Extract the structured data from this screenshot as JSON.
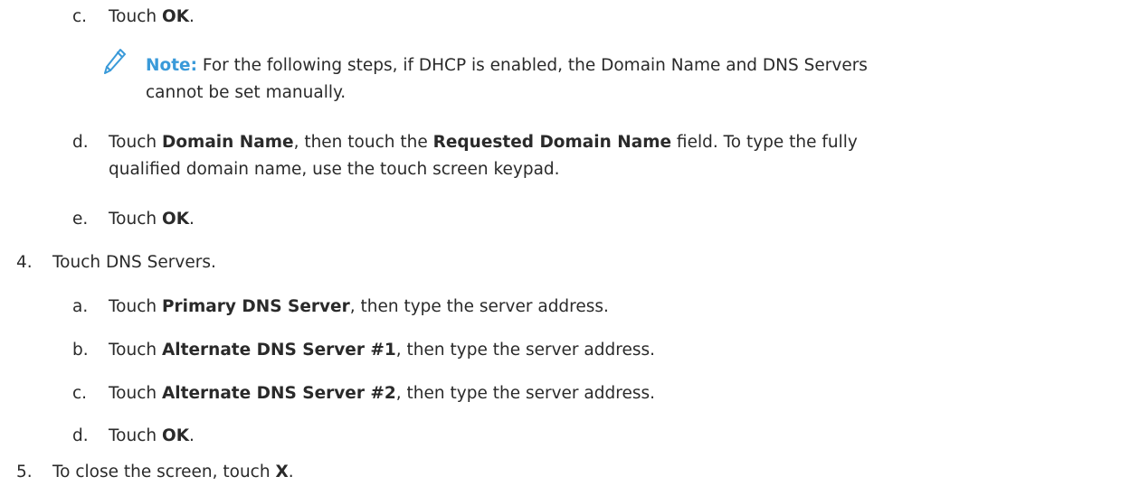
{
  "steps": [
    {
      "marker": "c.",
      "parts": [
        {
          "t": "Touch "
        },
        {
          "t": "OK",
          "b": true
        },
        {
          "t": "."
        }
      ]
    },
    {
      "marker": "d.",
      "parts": [
        {
          "t": "Touch "
        },
        {
          "t": "Domain Name",
          "b": true
        },
        {
          "t": ", then touch the "
        },
        {
          "t": "Requested Domain Name",
          "b": true
        },
        {
          "t": " field. To type the fully"
        }
      ],
      "continuation": "qualified domain name, use the touch screen keypad."
    },
    {
      "marker": "e.",
      "parts": [
        {
          "t": "Touch "
        },
        {
          "t": "OK",
          "b": true
        },
        {
          "t": "."
        }
      ]
    },
    {
      "marker": "4.",
      "parts": [
        {
          "t": "Touch DNS Servers."
        }
      ]
    },
    {
      "marker": "a.",
      "parts": [
        {
          "t": "Touch "
        },
        {
          "t": "Primary DNS Server",
          "b": true
        },
        {
          "t": ", then type the server address."
        }
      ]
    },
    {
      "marker": "b.",
      "parts": [
        {
          "t": "Touch "
        },
        {
          "t": "Alternate DNS Server #1",
          "b": true
        },
        {
          "t": ", then type the server address."
        }
      ]
    },
    {
      "marker": "c.",
      "parts": [
        {
          "t": "Touch "
        },
        {
          "t": "Alternate DNS Server #2",
          "b": true
        },
        {
          "t": ", then type the server address."
        }
      ]
    },
    {
      "marker": "d.",
      "parts": [
        {
          "t": "Touch "
        },
        {
          "t": "OK",
          "b": true
        },
        {
          "t": "."
        }
      ]
    },
    {
      "marker": "5.",
      "parts": [
        {
          "t": "To close the screen, touch "
        },
        {
          "t": "X",
          "b": true
        },
        {
          "t": "."
        }
      ]
    }
  ],
  "note": {
    "label": "Note:",
    "line1": " For the following steps, if DHCP is enabled, the Domain Name and DNS Servers",
    "line2": "cannot be set manually.",
    "icon": "pencil-icon",
    "accent_color": "#3a9ad9"
  }
}
